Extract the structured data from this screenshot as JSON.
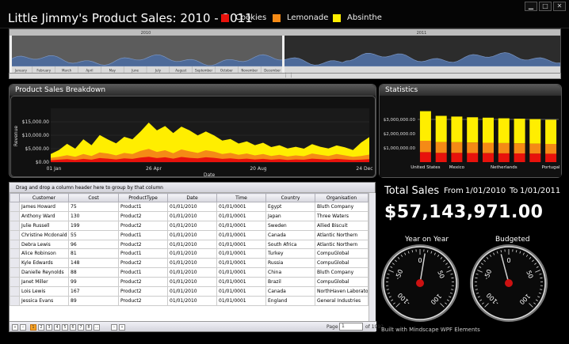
{
  "app": {
    "title": "Little Jimmy's Product Sales: 2010 - 2011",
    "window_buttons": [
      "▁",
      "□",
      "✕"
    ]
  },
  "legend": [
    {
      "label": "Cookies",
      "color": "#e8120c"
    },
    {
      "label": "Lemonade",
      "color": "#f58a16"
    },
    {
      "label": "Absinthe",
      "color": "#ffee00"
    }
  ],
  "navigator": {
    "years": [
      "2010",
      "2011"
    ],
    "months": [
      "January",
      "February",
      "March",
      "April",
      "May",
      "June",
      "July",
      "August",
      "September",
      "October",
      "November",
      "December"
    ]
  },
  "breakdown": {
    "title": "Product Sales Breakdown",
    "chart_data": {
      "type": "area",
      "ylabel": "Revenue",
      "xlabel": "Date",
      "y_ticks": [
        "$15,000.00",
        "$10,000.00",
        "$5,000.00",
        "$0.00"
      ],
      "x_ticks": [
        "01 Jan",
        "26 Apr",
        "20 Aug",
        "24 Dec"
      ],
      "ylim": [
        0,
        20000
      ],
      "series": [
        {
          "name": "Cookies",
          "color": "#e8120c",
          "values": [
            700,
            900,
            1100,
            800,
            1200,
            900,
            1500,
            1300,
            1000,
            1400,
            1200,
            1700,
            2000,
            1500,
            1800,
            1300,
            1900,
            1600,
            1400,
            1800,
            1600,
            1200,
            1400,
            1100,
            1300,
            1000,
            1200,
            900,
            1100,
            800,
            1000,
            900,
            1300,
            1100,
            900,
            1200,
            1000,
            800,
            900,
            1100
          ]
        },
        {
          "name": "Lemonade",
          "color": "#f58a16",
          "values": [
            900,
            1100,
            1500,
            1200,
            1800,
            1400,
            2100,
            1900,
            1500,
            2000,
            1800,
            2500,
            2900,
            2300,
            2600,
            2000,
            2800,
            2400,
            2000,
            2600,
            2300,
            1800,
            2000,
            1600,
            1900,
            1500,
            1800,
            1400,
            1600,
            1300,
            1500,
            1300,
            1900,
            1600,
            1400,
            1800,
            1500,
            1200,
            1400,
            1700
          ]
        },
        {
          "name": "Absinthe",
          "color": "#ffee00",
          "values": [
            1400,
            2500,
            4200,
            3000,
            5500,
            4000,
            6500,
            5200,
            4500,
            6000,
            5500,
            7200,
            9800,
            8000,
            9000,
            7500,
            8500,
            7800,
            6500,
            7000,
            6000,
            5000,
            5200,
            4200,
            4500,
            3800,
            4200,
            3300,
            3600,
            3000,
            3200,
            2800,
            3500,
            3000,
            2800,
            3200,
            3000,
            2500,
            5000,
            6500
          ]
        }
      ]
    }
  },
  "statistics": {
    "title": "Statistics",
    "chart_data": {
      "type": "bar",
      "y_ticks": [
        "$3,000,000.00",
        "$2,000,000.00",
        "$1,000,000.00"
      ],
      "ylim": [
        0,
        4000000
      ],
      "categories": [
        "United States",
        "",
        "Mexico",
        "",
        "",
        "Netherlands",
        "",
        "",
        "Portugal"
      ],
      "x_labels_shown": [
        "United States",
        "Mexico",
        "Netherlands",
        "Portugal"
      ],
      "reference_line": 3000000,
      "series": [
        {
          "name": "Cookies",
          "color": "#e8120c",
          "values": [
            700000,
            650000,
            650000,
            640000,
            630000,
            620000,
            610000,
            600000,
            590000
          ]
        },
        {
          "name": "Lemonade",
          "color": "#f58a16",
          "values": [
            800000,
            760000,
            750000,
            740000,
            730000,
            720000,
            710000,
            700000,
            690000
          ]
        },
        {
          "name": "Absinthe",
          "color": "#ffee00",
          "values": [
            2080000,
            1840000,
            1800000,
            1770000,
            1760000,
            1740000,
            1730000,
            1720000,
            1700000
          ]
        }
      ]
    }
  },
  "grid": {
    "group_hint": "Drag and drop a column header here to group by that column",
    "columns": [
      "Customer",
      "Cost",
      "ProductType",
      "Date",
      "Time",
      "Country",
      "Organisation"
    ],
    "rows": [
      [
        "James Howard",
        "75",
        "Product1",
        "01/01/2010",
        "01/01/0001",
        "Egypt",
        "Bluth Company"
      ],
      [
        "Anthony Ward",
        "130",
        "Product2",
        "01/01/2010",
        "01/01/0001",
        "Japan",
        "Three Waters"
      ],
      [
        "Julie Russell",
        "199",
        "Product2",
        "01/01/2010",
        "01/01/0001",
        "Sweden",
        "Allied Biscuit"
      ],
      [
        "Christine Mcdonald",
        "55",
        "Product1",
        "01/01/2010",
        "01/01/0001",
        "Canada",
        "Atlantic Northern"
      ],
      [
        "Debra Lewis",
        "96",
        "Product2",
        "01/01/2010",
        "01/01/0001",
        "South Africa",
        "Atlantic Northern"
      ],
      [
        "Alice Robinson",
        "81",
        "Product1",
        "01/01/2010",
        "01/01/0001",
        "Turkey",
        "CompuGlobal"
      ],
      [
        "Kyle Edwards",
        "148",
        "Product2",
        "01/01/2010",
        "01/01/0001",
        "Russia",
        "CompuGlobal"
      ],
      [
        "Danielle Reynolds",
        "88",
        "Product1",
        "01/01/2010",
        "01/01/0001",
        "China",
        "Bluth Company"
      ],
      [
        "Janet Miller",
        "99",
        "Product2",
        "01/01/2010",
        "01/01/0001",
        "Brazil",
        "CompuGlobal"
      ],
      [
        "Lois Lewis",
        "167",
        "Product2",
        "01/01/2010",
        "01/01/0001",
        "Canada",
        "NorthHaven Laborator"
      ],
      [
        "Jessica Evans",
        "89",
        "Product2",
        "01/01/2010",
        "01/01/0001",
        "England",
        "General Industries"
      ]
    ],
    "pager": {
      "first": "«",
      "prev": "‹",
      "pages": [
        "1",
        "2",
        "3",
        "4",
        "5",
        "6",
        "7",
        "8",
        "..."
      ],
      "next": "›",
      "last": "»",
      "page_label": "Page",
      "page_value": "1",
      "of_label": "of 1992"
    }
  },
  "totals": {
    "label": "Total Sales",
    "from_label": "From",
    "from_date": "1/01/2010",
    "to_label": "To",
    "to_date": "1/01/2011",
    "value": "$57,143,971.00"
  },
  "gauges": [
    {
      "title": "Year on Year",
      "labels": [
        "-100",
        "-50",
        "0",
        "50",
        "100"
      ],
      "value": 7
    },
    {
      "title": "Budgeted",
      "labels": [
        "-100",
        "-50",
        "0",
        "50",
        "100"
      ],
      "value": -11
    }
  ],
  "footer": "Built with Mindscape WPF Elements"
}
